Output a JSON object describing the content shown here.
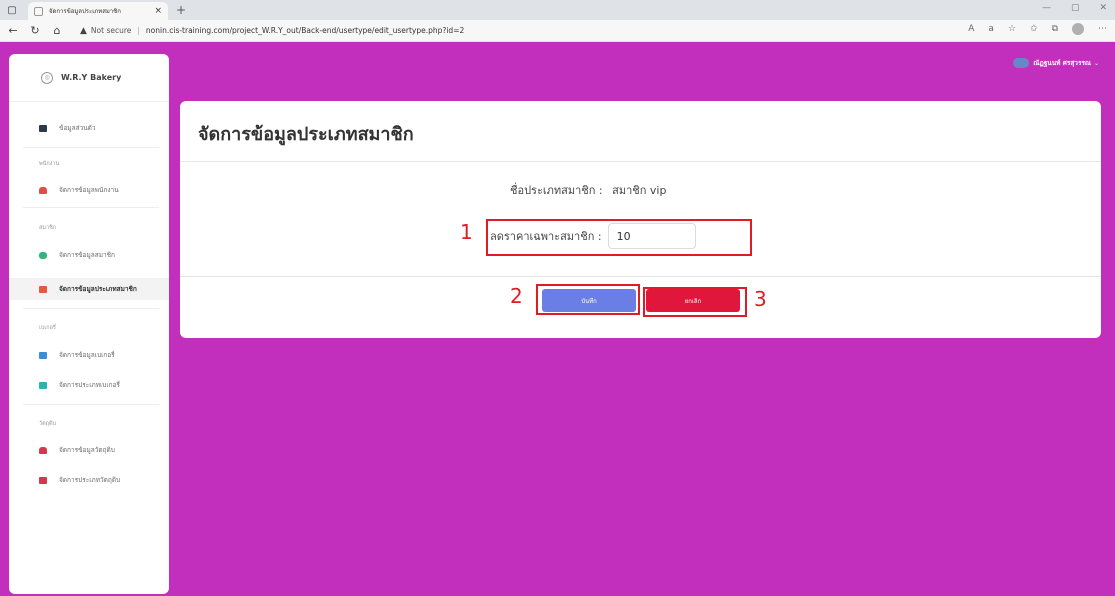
{
  "browser": {
    "tab_title": "จัดการข้อมูลประเภทสมาชิก",
    "tab_close": "×",
    "new_tab": "+",
    "not_secure": "Not secure",
    "url": "nonin.cis-training.com/project_W.R.Y_out/Back-end/usertype/edit_usertype.php?id=2",
    "min": "—",
    "restore": "▢",
    "close": "✕"
  },
  "sidebar": {
    "brand": "W.R.Y Bakery",
    "items": [
      {
        "label": "ข้อมูลส่วนตัว",
        "color": "#2b3a4a",
        "active": false
      },
      {
        "section": "พนักงาน"
      },
      {
        "label": "จัดการข้อมูลพนักงาน",
        "color": "#e44c4c",
        "active": false
      },
      {
        "section": "สมาชิก"
      },
      {
        "label": "จัดการข้อมูลสมาชิก",
        "color": "#2fb67a",
        "active": false
      },
      {
        "label": "จัดการข้อมูลประเภทสมาชิก",
        "color": "#e55a3c",
        "active": true
      },
      {
        "section": "เบเกอรี่"
      },
      {
        "label": "จัดการข้อมูลเบเกอรี่",
        "color": "#3a8dd9",
        "active": false
      },
      {
        "label": "จัดการประเภทเบเกอรี่",
        "color": "#2bb3b0",
        "active": false
      },
      {
        "section": "วัตถุดิบ"
      },
      {
        "label": "จัดการข้อมูลวัตถุดิบ",
        "color": "#d9364e",
        "active": false
      },
      {
        "label": "จัดการประเภทวัตถุดิบ",
        "color": "#d9364e",
        "active": false
      }
    ]
  },
  "user": {
    "name": "ณัฏฐนนท์ ศรสุวรรณ",
    "chevron": "⌄"
  },
  "main": {
    "title": "จัดการข้อมูลประเภทสมาชิก",
    "type_label": "ชื่อประเภทสมาชิก :",
    "type_value": "สมาชิก vip",
    "discount_label": "ลดราคาเฉพาะสมาชิก :",
    "discount_value": "10",
    "save_label": "บันทึก",
    "cancel_label": "ยกเลิก"
  },
  "annotations": [
    "1",
    "2",
    "3"
  ],
  "colors": {
    "background": "#c22fbd",
    "save": "#6a7ee6",
    "cancel": "#e0163c",
    "annotation": "#e01b24"
  }
}
